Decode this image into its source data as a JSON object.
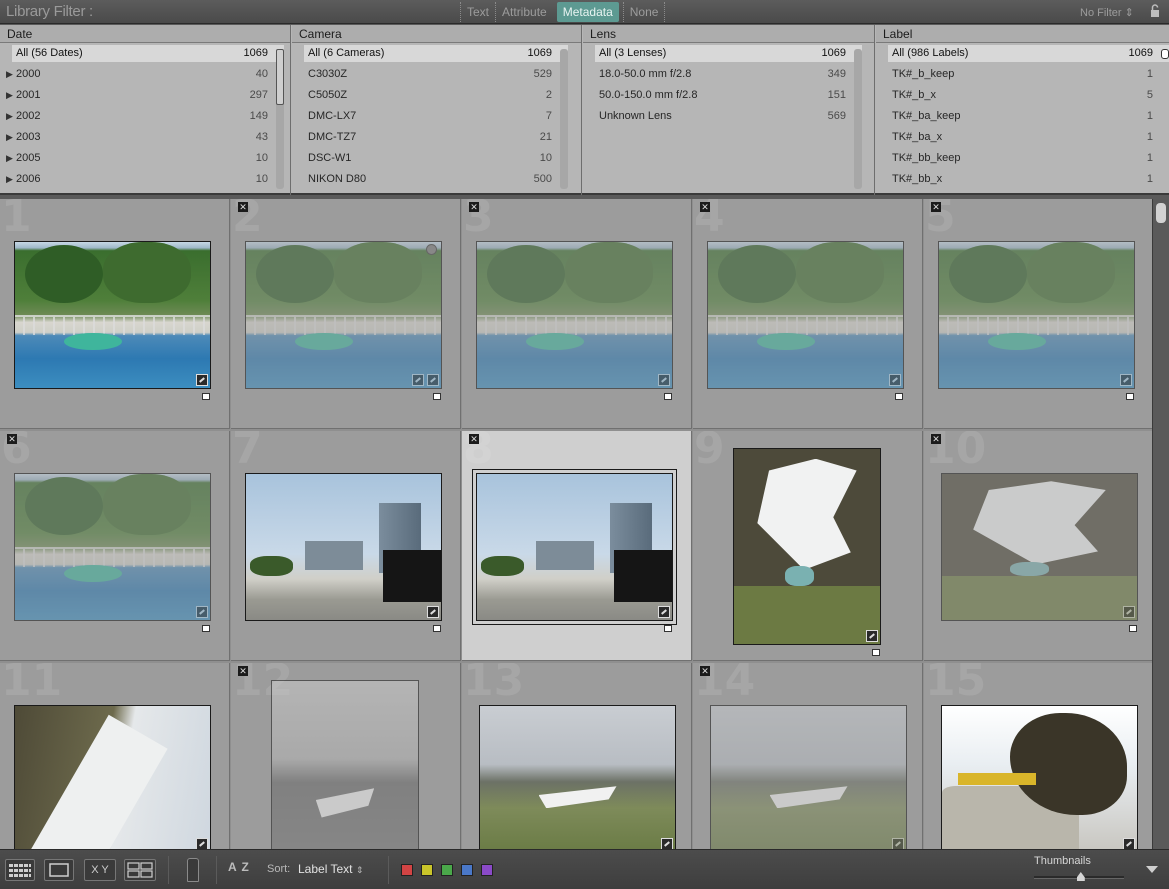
{
  "filter_bar": {
    "title": "Library Filter :",
    "modes": [
      "Text",
      "Attribute",
      "Metadata",
      "None"
    ],
    "active_mode": "Metadata",
    "preset": "No Filter",
    "lock_icon": "lock-icon"
  },
  "metadata_columns": [
    {
      "header": "Date",
      "rows": [
        {
          "label": "All (56 Dates)",
          "count": "1069",
          "selected": true,
          "tree": false
        },
        {
          "label": "2000",
          "count": "40",
          "selected": false,
          "tree": true
        },
        {
          "label": "2001",
          "count": "297",
          "selected": false,
          "tree": true
        },
        {
          "label": "2002",
          "count": "149",
          "selected": false,
          "tree": true
        },
        {
          "label": "2003",
          "count": "43",
          "selected": false,
          "tree": true
        },
        {
          "label": "2005",
          "count": "10",
          "selected": false,
          "tree": true
        },
        {
          "label": "2006",
          "count": "10",
          "selected": false,
          "tree": true
        }
      ]
    },
    {
      "header": "Camera",
      "rows": [
        {
          "label": "All (6 Cameras)",
          "count": "1069",
          "selected": true,
          "tree": false
        },
        {
          "label": "C3030Z",
          "count": "529",
          "selected": false,
          "tree": false
        },
        {
          "label": "C5050Z",
          "count": "2",
          "selected": false,
          "tree": false
        },
        {
          "label": "DMC-LX7",
          "count": "7",
          "selected": false,
          "tree": false
        },
        {
          "label": "DMC-TZ7",
          "count": "21",
          "selected": false,
          "tree": false
        },
        {
          "label": "DSC-W1",
          "count": "10",
          "selected": false,
          "tree": false
        },
        {
          "label": "NIKON D80",
          "count": "500",
          "selected": false,
          "tree": false
        }
      ]
    },
    {
      "header": "Lens",
      "rows": [
        {
          "label": "All (3 Lenses)",
          "count": "1069",
          "selected": true,
          "tree": false
        },
        {
          "label": "18.0-50.0 mm f/2.8",
          "count": "349",
          "selected": false,
          "tree": false
        },
        {
          "label": "50.0-150.0 mm f/2.8",
          "count": "151",
          "selected": false,
          "tree": false
        },
        {
          "label": "Unknown Lens",
          "count": "569",
          "selected": false,
          "tree": false
        }
      ]
    },
    {
      "header": "Label",
      "rows": [
        {
          "label": "All (986 Labels)",
          "count": "1069",
          "selected": true,
          "tree": false
        },
        {
          "label": "TK#_b_keep",
          "count": "1",
          "selected": false,
          "tree": false
        },
        {
          "label": "TK#_b_x",
          "count": "5",
          "selected": false,
          "tree": false
        },
        {
          "label": "TK#_ba_keep",
          "count": "1",
          "selected": false,
          "tree": false
        },
        {
          "label": "TK#_ba_x",
          "count": "1",
          "selected": false,
          "tree": false
        },
        {
          "label": "TK#_bb_keep",
          "count": "1",
          "selected": false,
          "tree": false
        },
        {
          "label": "TK#_bb_x",
          "count": "1",
          "selected": false,
          "tree": false
        }
      ]
    }
  ],
  "grid": {
    "cells": [
      {
        "index": "1",
        "image": "pool",
        "rejected": false,
        "dimmed": false,
        "selected": false
      },
      {
        "index": "2",
        "image": "pool",
        "rejected": true,
        "dimmed": true,
        "selected": false
      },
      {
        "index": "3",
        "image": "pool",
        "rejected": true,
        "dimmed": true,
        "selected": false
      },
      {
        "index": "4",
        "image": "pool",
        "rejected": true,
        "dimmed": true,
        "selected": false
      },
      {
        "index": "5",
        "image": "pool",
        "rejected": true,
        "dimmed": true,
        "selected": false
      },
      {
        "index": "6",
        "image": "pool",
        "rejected": true,
        "dimmed": true,
        "selected": false
      },
      {
        "index": "7",
        "image": "city",
        "rejected": false,
        "dimmed": false,
        "selected": false
      },
      {
        "index": "8",
        "image": "city",
        "rejected": true,
        "dimmed": false,
        "selected": true
      },
      {
        "index": "9",
        "image": "snow",
        "rejected": false,
        "dimmed": false,
        "selected": false
      },
      {
        "index": "10",
        "image": "snow",
        "rejected": true,
        "dimmed": true,
        "selected": false
      },
      {
        "index": "11",
        "image": "slope",
        "rejected": false,
        "dimmed": false,
        "selected": false
      },
      {
        "index": "12",
        "image": "ridge-bw",
        "rejected": true,
        "dimmed": true,
        "selected": false
      },
      {
        "index": "13",
        "image": "ridge",
        "rejected": false,
        "dimmed": false,
        "selected": false
      },
      {
        "index": "14",
        "image": "ridge",
        "rejected": true,
        "dimmed": true,
        "selected": false
      },
      {
        "index": "15",
        "image": "rock",
        "rejected": false,
        "dimmed": false,
        "selected": false
      }
    ]
  },
  "toolbar": {
    "view_buttons": [
      "grid-view-icon",
      "loupe-view-icon",
      "compare-view-icon",
      "survey-view-icon"
    ],
    "compare_label": "X Y",
    "painter_icon": "spray-can-icon",
    "sort_direction_label": "A Z",
    "sort_label": "Sort:",
    "sort_value": "Label Text",
    "color_labels": [
      "#d24444",
      "#c9c52a",
      "#4aa84a",
      "#4a78c8",
      "#8a4ac8"
    ],
    "thumbnails_label": "Thumbnails",
    "thumbnail_size": 0.52
  }
}
